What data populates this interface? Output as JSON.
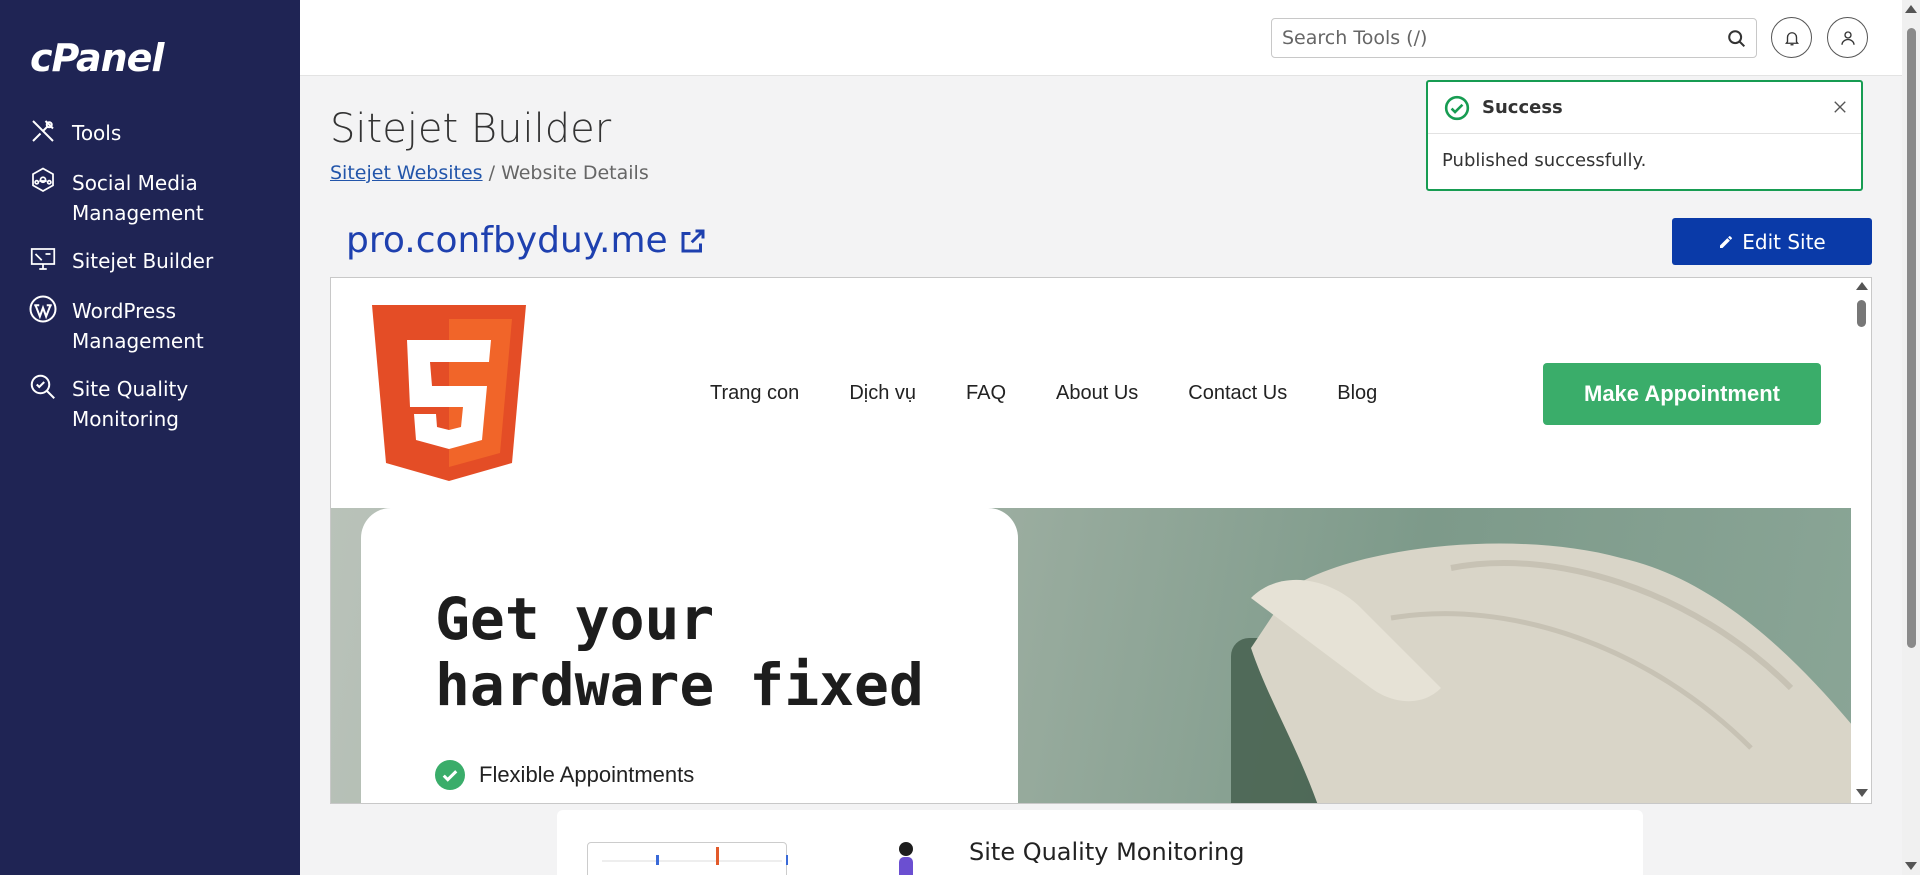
{
  "brand": {
    "logo_text": "cPanel"
  },
  "sidebar": {
    "items": [
      {
        "label": "Tools",
        "icon": "tools-icon"
      },
      {
        "label": "Social Media Management",
        "icon": "social-media-icon"
      },
      {
        "label": "Sitejet Builder",
        "icon": "sitejet-icon"
      },
      {
        "label": "WordPress Management",
        "icon": "wordpress-icon"
      },
      {
        "label": "Site Quality Monitoring",
        "icon": "site-quality-icon"
      }
    ]
  },
  "header": {
    "search": {
      "placeholder": "Search Tools (/)"
    }
  },
  "page": {
    "title": "Sitejet Builder",
    "breadcrumb": {
      "link": "Sitejet Websites",
      "separator": " / ",
      "current": "Website Details"
    },
    "site_url": "pro.confbyduy.me",
    "edit_button": "Edit Site"
  },
  "toast": {
    "title": "Success",
    "message": "Published successfully.",
    "accent": "#179c52"
  },
  "preview": {
    "nav": [
      "Trang con",
      "Dịch vụ",
      "FAQ",
      "About Us",
      "Contact Us",
      "Blog"
    ],
    "cta": "Make Appointment",
    "hero_title_line1": "Get your",
    "hero_title_line2": "hardware fixed",
    "bullet": "Flexible Appointments",
    "cta_color": "#3aad6a"
  },
  "bottom_card": {
    "title": "Site Quality Monitoring"
  }
}
